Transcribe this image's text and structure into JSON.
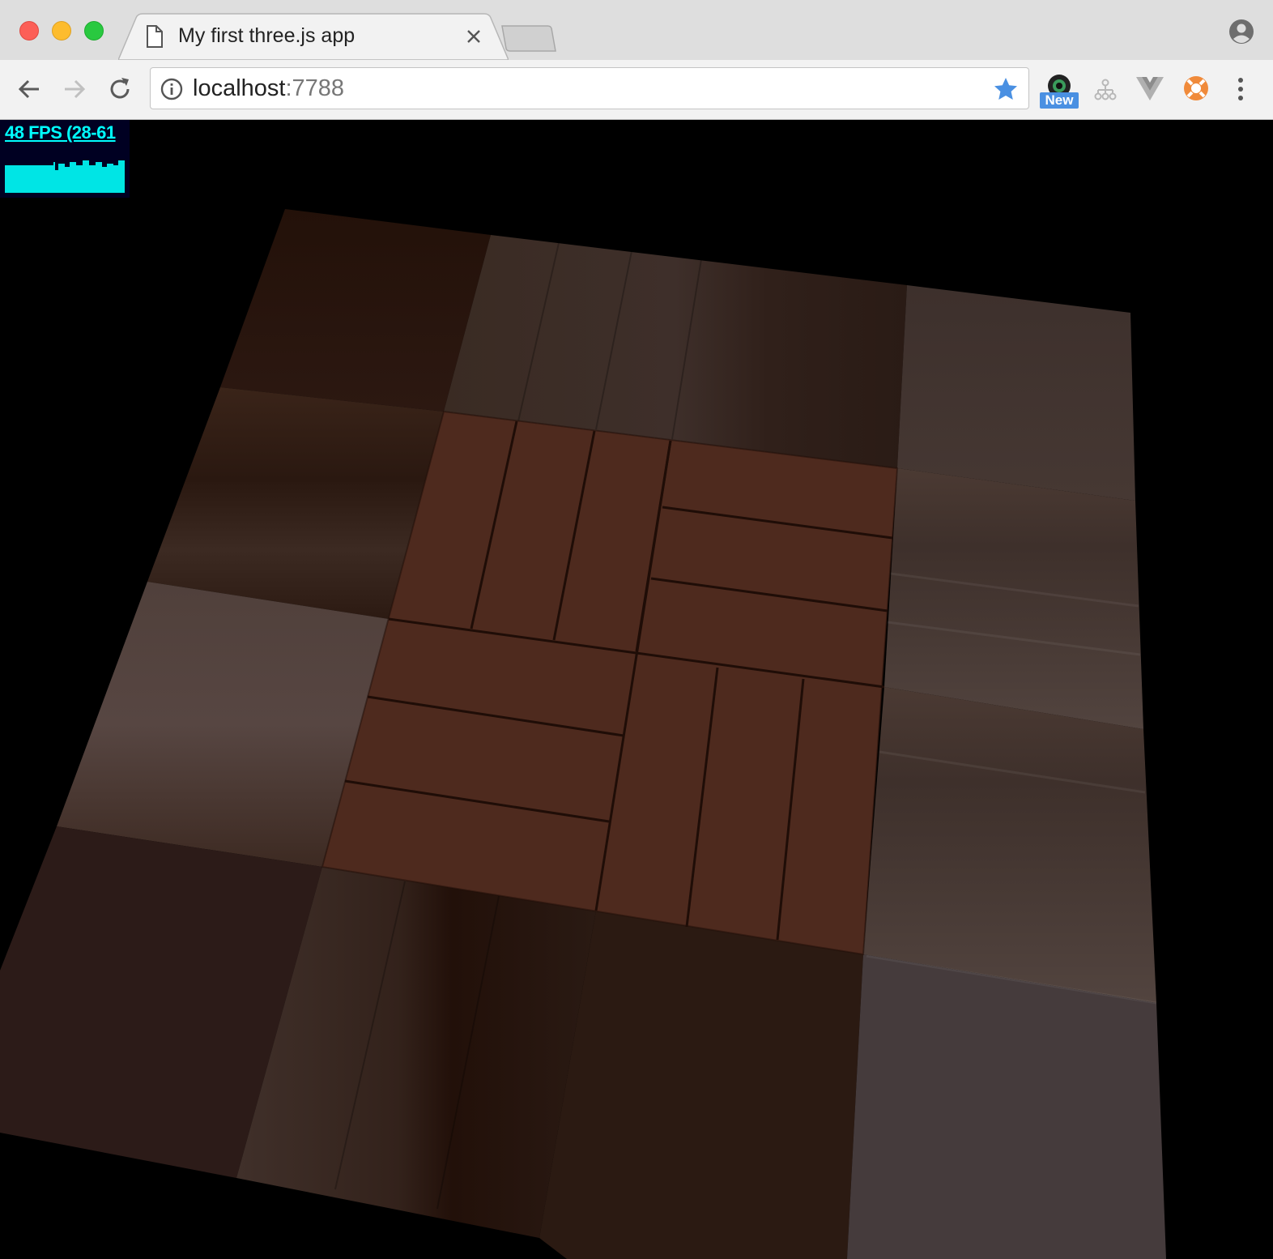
{
  "tab": {
    "title": "My first three.js app"
  },
  "omnibox": {
    "host": "localhost",
    "port": ":7788"
  },
  "extensions": {
    "new_badge": "New"
  },
  "stats": {
    "fps_text": "48 FPS (28-61"
  },
  "colors": {
    "fps_cyan": "#00e5e5",
    "star_blue": "#4a90e2",
    "brick": "#4e2a1e"
  },
  "icons": [
    "page-icon",
    "close-icon",
    "back-arrow-icon",
    "forward-arrow-icon",
    "reload-icon",
    "info-icon",
    "star-icon",
    "profile-icon",
    "camera-extension-icon",
    "sitemap-extension-icon",
    "vue-extension-icon",
    "lifebuoy-extension-icon",
    "menu-dots-icon"
  ]
}
